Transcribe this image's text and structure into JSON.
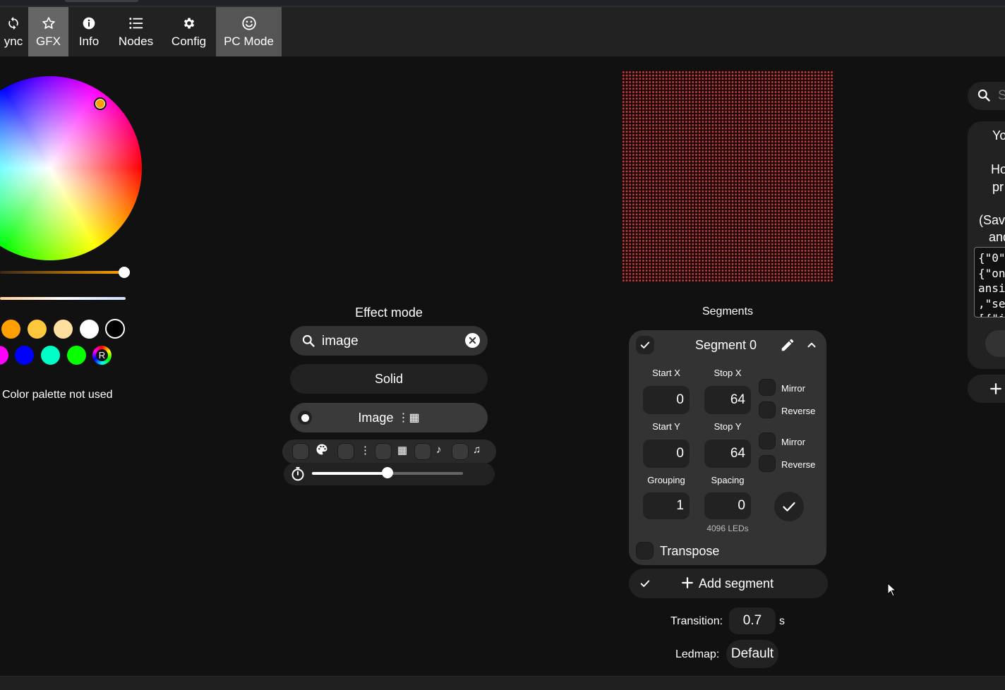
{
  "nav": {
    "tabs": [
      {
        "label": "ync",
        "icon": "sync-icon"
      },
      {
        "label": "GFX",
        "icon": "star-icon"
      },
      {
        "label": "Info",
        "icon": "info-icon"
      },
      {
        "label": "Nodes",
        "icon": "list-icon"
      },
      {
        "label": "Config",
        "icon": "gear-icon"
      },
      {
        "label": "PC Mode",
        "icon": "smiley-icon"
      }
    ]
  },
  "colors": {
    "accent": "#ffa000",
    "panel": "#333333",
    "dark": "#222222",
    "background": "#111111",
    "led": "#c84040"
  },
  "color_picker": {
    "brightness": 0.97,
    "swatches": [
      "#ffa000",
      "#ffc83c",
      "#ffe0a0",
      "#ffffff",
      "#000000",
      "#ff00ff",
      "#0000ff",
      "#00ffc8",
      "#08ff00",
      "random"
    ],
    "random_label": "R",
    "palette_note": "Color palette not used"
  },
  "effect": {
    "title": "Effect mode",
    "search_value": "image",
    "items": [
      {
        "label": "Solid",
        "selected": false
      },
      {
        "label": "Image",
        "glyph": "⋮▦",
        "selected": true
      }
    ],
    "filters": [
      "palette",
      "⋮",
      "▦",
      "♪",
      "♫"
    ],
    "speed": 0.5
  },
  "segments": {
    "title": "Segments",
    "segment": {
      "name": "Segment 0",
      "start_x_label": "Start X",
      "stop_x_label": "Stop X",
      "start_y_label": "Start Y",
      "stop_y_label": "Stop Y",
      "start_x": "0",
      "stop_x": "64",
      "start_y": "0",
      "stop_y": "64",
      "grouping_label": "Grouping",
      "spacing_label": "Spacing",
      "grouping": "1",
      "spacing": "0",
      "mirror_label": "Mirror",
      "reverse_label": "Reverse",
      "led_count": "4096 LEDs",
      "transpose_label": "Transpose"
    },
    "add_label": "Add segment",
    "transition_label": "Transition:",
    "transition_value": "0.7",
    "transition_unit": "s",
    "ledmap_label": "Ledmap:",
    "ledmap_value": "Default"
  },
  "right_panel": {
    "search_placeholder": "S",
    "lines": [
      "Yo",
      "Ho",
      "pr",
      "(Sav",
      "and"
    ],
    "code": "{\"0\"\n{\"on\nansi\n,\"se\n[{\"i"
  }
}
